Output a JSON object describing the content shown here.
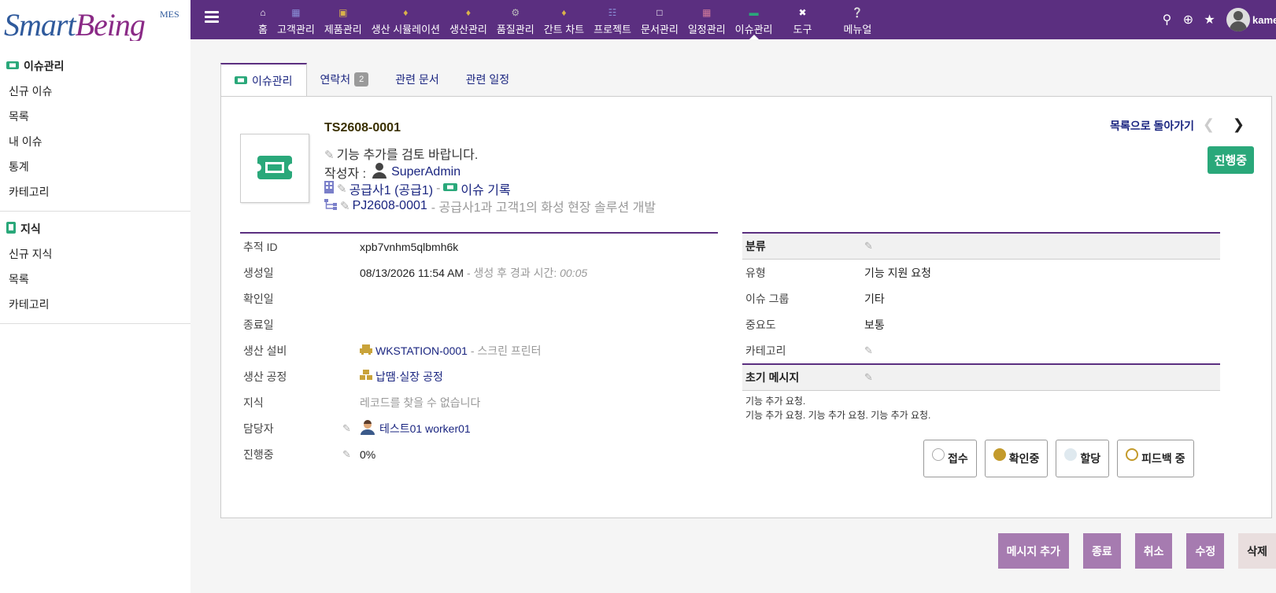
{
  "logo": {
    "brand_smart": "Smart",
    "brand_being": "Being",
    "brand_mes": "MES"
  },
  "topbar": {
    "nav": [
      {
        "icon": "home-icon",
        "label": "홈"
      },
      {
        "icon": "building-icon",
        "label": "고객관리"
      },
      {
        "icon": "box-icon",
        "label": "제품관리"
      },
      {
        "icon": "cubes-icon",
        "label": "생산 시뮬레이션"
      },
      {
        "icon": "cubes-icon",
        "label": "생산관리"
      },
      {
        "icon": "cogs-icon",
        "label": "품질관리"
      },
      {
        "icon": "cubes-icon",
        "label": "간트 차트"
      },
      {
        "icon": "sitemap-icon",
        "label": "프로젝트"
      },
      {
        "icon": "folder-icon",
        "label": "문서관리"
      },
      {
        "icon": "calendar-icon",
        "label": "일정관리"
      },
      {
        "icon": "ticket-icon",
        "label": "이슈관리"
      },
      {
        "icon": "tools-icon",
        "label": "도구"
      },
      {
        "icon": "question-icon",
        "label": "메뉴얼"
      }
    ],
    "active_nav": "이슈관리",
    "username": "kame"
  },
  "sidebar": {
    "sections": [
      {
        "title": "이슈관리",
        "icon": "ticket-icon",
        "items": [
          "신규 이슈",
          "목록",
          "내 이슈",
          "통계",
          "카테고리"
        ]
      },
      {
        "title": "지식",
        "icon": "book-icon",
        "items": [
          "신규 지식",
          "목록",
          "카테고리"
        ]
      }
    ]
  },
  "tabs": [
    {
      "label": "이슈관리",
      "active": true
    },
    {
      "label": "연락처",
      "badge": "2"
    },
    {
      "label": "관련 문서"
    },
    {
      "label": "관련 일정"
    }
  ],
  "issue": {
    "number": "TS2608-0001",
    "title": "기능 추가를 검토 바랍니다.",
    "author_label": "작성자 :",
    "author": "SuperAdmin",
    "company": "공급사1 (공급1)",
    "separator": "-",
    "record": "이슈 기록",
    "project": "PJ2608-0001",
    "project_desc": "- 공급사1과 고객1의 화성 현장 솔루션 개발",
    "back_link": "목록으로 돌아가기",
    "status": "진행중"
  },
  "details": {
    "tracking_id_label": "추적 ID",
    "tracking_id": "xpb7vnhm5qlbmh6k",
    "created_label": "생성일",
    "created": "08/13/2026 11:54 AM",
    "elapsed_label": "- 생성 후 경과 시간:",
    "elapsed": "00:05",
    "confirmed_label": "확인일",
    "closed_label": "종료일",
    "equipment_label": "생산 설비",
    "equipment": "WKSTATION-0001",
    "equipment_desc": "- 스크린 프린터",
    "process_label": "생산 공정",
    "process": "납땜·실장 공정",
    "knowledge_label": "지식",
    "knowledge": "레코드를 찾을 수 없습니다",
    "assignee_label": "담당자",
    "assignee": "테스트01 worker01",
    "progress_label": "진행중",
    "progress": "0%"
  },
  "classification": {
    "header": "분류",
    "type_label": "유형",
    "type": "기능 지원 요청",
    "group_label": "이슈 그룹",
    "group": "기타",
    "severity_label": "중요도",
    "severity": "보통",
    "category_label": "카테고리"
  },
  "initial_message": {
    "header": "초기 메시지",
    "line1": "기능 추가 요청.",
    "line2": "기능 추가 요청. 기능 추가 요청. 기능 추가 요청."
  },
  "states": [
    {
      "label": "접수",
      "color": "#ffffff",
      "border": "#aaaaaa"
    },
    {
      "label": "확인중",
      "color": "#c39a2b",
      "border": "#c39a2b"
    },
    {
      "label": "할당",
      "color": "#dfe9ef",
      "border": "#dfe9ef"
    },
    {
      "label": "피드백 중",
      "color": "#ffffff",
      "border": "#c39a2b"
    }
  ],
  "actions": [
    "메시지 추가",
    "종료",
    "취소",
    "수정",
    "삭제"
  ],
  "colors": {
    "brand": "#5b2f80",
    "status": "#2aa87a",
    "action": "#a67bb0",
    "link": "#1a2580"
  }
}
